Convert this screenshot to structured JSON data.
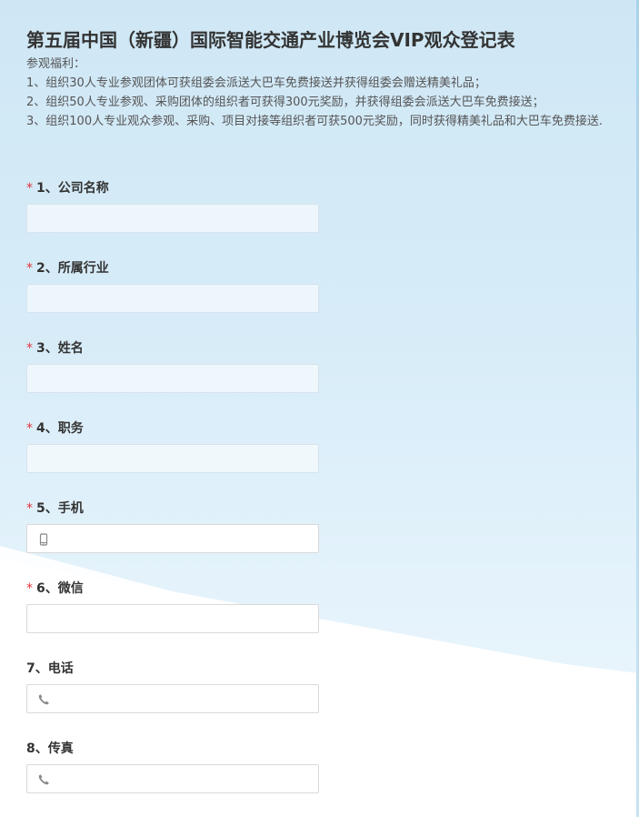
{
  "form": {
    "title": "第五届中国（新疆）国际智能交通产业博览会VIP观众登记表",
    "description": [
      "参观福利：",
      "1、组织30人专业参观团体可获组委会派送大巴车免费接送并获得组委会赠送精美礼品；",
      "2、组织50人专业参观、采购团体的组织者可获得300元奖励，并获得组委会派送大巴车免费接送；",
      "3、组织100人专业观众参观、采购、项目对接等组织者可获500元奖励，同时获得精美礼品和大巴车免费接送."
    ]
  },
  "fields": [
    {
      "label": "1、公司名称",
      "required": true,
      "required_mark": "*",
      "value": ""
    },
    {
      "label": "2、所属行业",
      "required": true,
      "required_mark": "*",
      "value": ""
    },
    {
      "label": "3、姓名",
      "required": true,
      "required_mark": "*",
      "value": ""
    },
    {
      "label": "4、职务",
      "required": true,
      "required_mark": "*",
      "value": ""
    },
    {
      "label": "5、手机",
      "required": true,
      "required_mark": "*",
      "value": "",
      "icon": "mobile-phone-icon"
    },
    {
      "label": "6、微信",
      "required": true,
      "required_mark": "*",
      "value": ""
    },
    {
      "label": "7、电话",
      "required": false,
      "value": "",
      "icon": "telephone-icon"
    },
    {
      "label": "8、传真",
      "required": false,
      "value": "",
      "icon": "telephone-icon"
    }
  ],
  "colors": {
    "required": "#e0353b",
    "background_top": "#cfe7f5",
    "background_bottom": "#ffffff"
  }
}
